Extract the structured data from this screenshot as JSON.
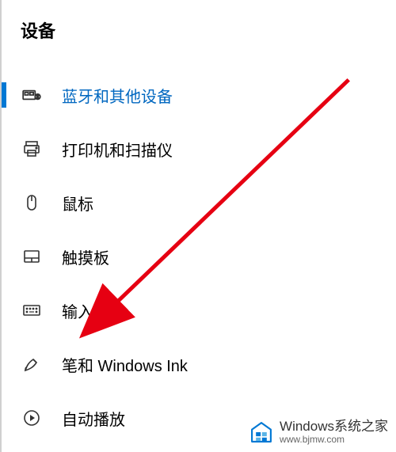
{
  "page_title": "设备",
  "nav": {
    "items": [
      {
        "key": "bluetooth",
        "label": "蓝牙和其他设备",
        "selected": true
      },
      {
        "key": "printers",
        "label": "打印机和扫描仪",
        "selected": false
      },
      {
        "key": "mouse",
        "label": "鼠标",
        "selected": false
      },
      {
        "key": "touchpad",
        "label": "触摸板",
        "selected": false
      },
      {
        "key": "typing",
        "label": "输入",
        "selected": false
      },
      {
        "key": "pen",
        "label": "笔和 Windows Ink",
        "selected": false
      },
      {
        "key": "autoplay",
        "label": "自动播放",
        "selected": false
      }
    ]
  },
  "watermark": {
    "line1_a": "Windows",
    "line1_b": "系统之家",
    "line2": "www.bjmw.com"
  },
  "annotation": {
    "arrow_color": "#e60012"
  }
}
